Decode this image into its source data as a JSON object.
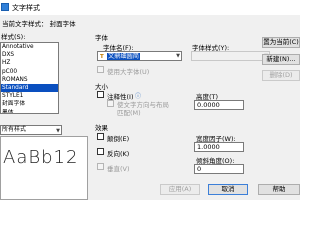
{
  "window": {
    "title": "文字样式"
  },
  "current_style_label": "当前文字样式：  封面字体",
  "styles": {
    "label": "样式(S):",
    "items": [
      "Annotative",
      "DXS",
      "HZ",
      "pC00",
      "ROMANS",
      "Standard",
      "STYLE1",
      "封面字体",
      "黑体"
    ],
    "selected_index": 5
  },
  "filter": {
    "value": "所有样式"
  },
  "preview": {
    "text": "AaBb12"
  },
  "font": {
    "group_label": "字体",
    "name_label": "字体名(F):",
    "name_value": "文鼎细圆简",
    "style_label": "字体样式(Y):",
    "style_value": "",
    "bigfont_label": "使用大字体(U)"
  },
  "size": {
    "group_label": "大小",
    "annotative_label": "注释性(I)",
    "match_orientation_label": "使文字方向与布局",
    "match_orientation_label2": "匹配(M)",
    "height_label": "高度(T)",
    "height_value": "0.0000"
  },
  "effects": {
    "group_label": "效果",
    "upside_down_label": "颠倒(E)",
    "backwards_label": "反向(K)",
    "vertical_label": "垂直(V)",
    "width_factor_label": "宽度因子(W):",
    "width_factor_value": "1.0000",
    "oblique_label": "倾斜角度(O):",
    "oblique_value": "0"
  },
  "buttons": {
    "set_current": "置为当前(C)",
    "new": "新建(N)...",
    "delete": "删除(D)",
    "apply": "应用(A)",
    "cancel": "取消",
    "help": "帮助"
  }
}
